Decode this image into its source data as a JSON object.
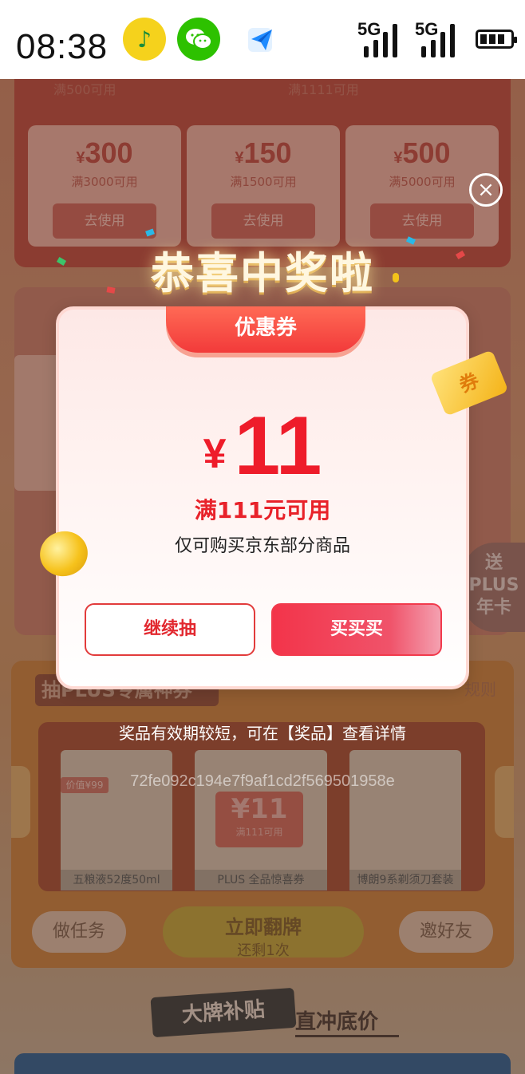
{
  "status_bar": {
    "time": "08:38",
    "network_1": "5G",
    "network_2": "5G"
  },
  "background": {
    "top_tickets": [
      {
        "condition": "满500可用"
      },
      {
        "condition": "满1111可用"
      }
    ],
    "tickets": [
      {
        "currency": "¥",
        "amount": "300",
        "condition": "满3000可用",
        "button": "去使用"
      },
      {
        "currency": "¥",
        "amount": "150",
        "condition": "满1500可用",
        "button": "去使用"
      },
      {
        "currency": "¥",
        "amount": "500",
        "condition": "满5000可用",
        "button": "去使用"
      }
    ],
    "plus_section_title": "抽PLUS专属神券",
    "rules_link": "规则",
    "prizes": [
      {
        "label": "五粮液52度50ml",
        "value_tag": "价值¥99"
      },
      {
        "label": "PLUS 全品惊喜券",
        "coupon_amount": "¥11",
        "coupon_condition": "满111可用"
      },
      {
        "label": "博朗9系剃须刀套装"
      }
    ],
    "task_button": "做任务",
    "flip_button": "立即翻牌",
    "flip_remaining": "还剩1次",
    "invite_button": "邀好友",
    "plus_badge": "送PLUS年卡",
    "brand_tag": "大牌补贴",
    "brand_subtitle": "直冲底价"
  },
  "modal": {
    "headline": "恭喜中奖啦",
    "close_icon": "×",
    "ribbon": "优惠券",
    "currency": "¥",
    "amount": "11",
    "condition": "满111元可用",
    "description": "仅可购买京东部分商品",
    "continue_button": "继续抽",
    "buy_button": "买买买",
    "ticket_icon_text": "券"
  },
  "footer_note": "奖品有效期较短，可在【奖品】查看详情",
  "watermark_hash": "72fe092c194e7f9af1cd2f569501958e",
  "colors": {
    "accent_red": "#ee1c2a",
    "ribbon_red": "#f23a3a",
    "coin_gold": "#f6c21c"
  }
}
